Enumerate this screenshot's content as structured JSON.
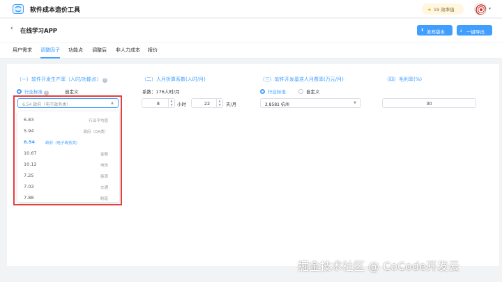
{
  "app": {
    "title": "软件成本造价工具",
    "coin_count": "19",
    "coin_label": "效率值",
    "brand_color": "#409eff"
  },
  "header": {
    "project": "在线学习APP",
    "publish_label": "发布版本",
    "export_label": "一键导出"
  },
  "tabs": [
    {
      "label": "用户需求"
    },
    {
      "label": "调整因子",
      "active": true
    },
    {
      "label": "功能点"
    },
    {
      "label": "调整后"
    },
    {
      "label": "非人力成本"
    },
    {
      "label": "报价"
    }
  ],
  "sections": {
    "productivity": {
      "title": "（一）软件开发生产率（人时/功能点）",
      "radio_industry": "行业标准",
      "radio_custom": "自定义",
      "selected_value": "6.54 政府（电子政务类）",
      "options": [
        {
          "value": "6.83",
          "category": "行业平均值"
        },
        {
          "value": "5.94",
          "category": "政府（OA类）"
        },
        {
          "value": "6.54",
          "category": "政府（电子政务类）",
          "selected": true
        },
        {
          "value": "10.67",
          "category": "金融"
        },
        {
          "value": "10.12",
          "category": "电信"
        },
        {
          "value": "7.25",
          "category": "能源"
        },
        {
          "value": "7.03",
          "category": "交通"
        },
        {
          "value": "7.88",
          "category": "制造"
        }
      ]
    },
    "hours": {
      "title": "（二）人月折算系数(人时/月)",
      "coefficient": "系数：176人时/月",
      "hours_per_day": "8",
      "hours_unit": "小时",
      "days_per_month": "22",
      "days_unit": "天/月"
    },
    "rate": {
      "title": "（三）软件开发基准人月费率(万元/月)",
      "radio_industry": "行业标准",
      "radio_custom": "自定义",
      "selected_value": "2.8581 杭州"
    },
    "margin": {
      "title": "（四）毛利率(%)",
      "value": "30"
    }
  },
  "watermark": "掘金技术社区 @ CoCode开发云"
}
